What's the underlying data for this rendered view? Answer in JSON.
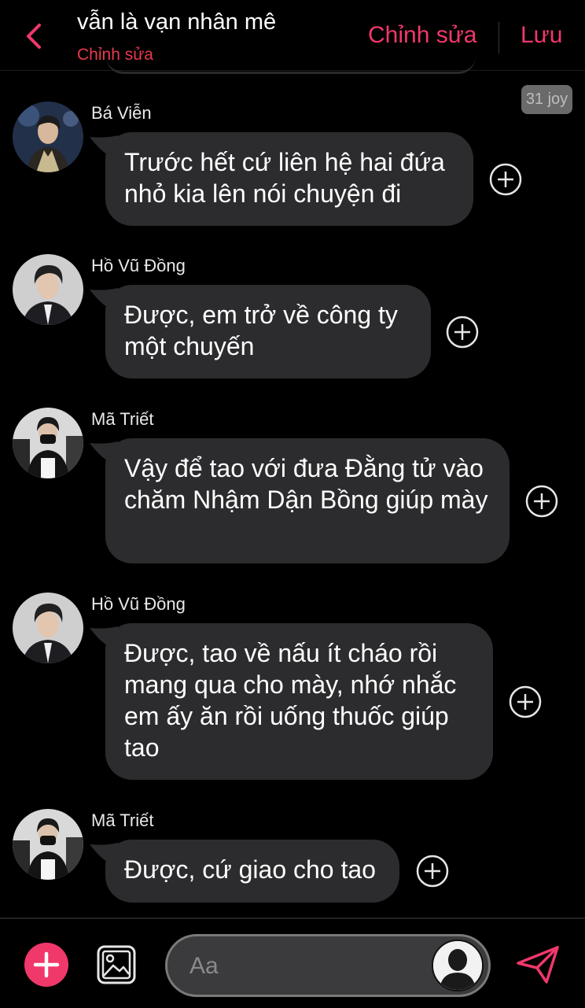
{
  "header": {
    "title": "vẫn là vạn nhân mê",
    "subtitle": "Chỉnh sửa",
    "edit_label": "Chỉnh sửa",
    "save_label": "Lưu",
    "accent": "#f0386b"
  },
  "timestamp": "31 joy",
  "messages": [
    {
      "sender": "Bá Viễn",
      "text": "Trước hết cứ liên hệ hai đứa nhỏ kia lên nói chuyện đi"
    },
    {
      "sender": "Hồ Vũ Đồng",
      "text": "Được, em trở về công ty một chuyến"
    },
    {
      "sender": "Mã Triết",
      "text": "Vậy để tao với đưa Đằng tử vào chăm Nhậm Dận Bồng giúp mày"
    },
    {
      "sender": "Hồ Vũ Đồng",
      "text": "Được, tao về nấu ít cháo rồi mang qua cho mày, nhớ nhắc em ấy ăn rồi uống thuốc giúp tao"
    },
    {
      "sender": "Mã Triết",
      "text": "Được, cứ giao cho tao"
    }
  ],
  "composer": {
    "placeholder": "Aa"
  },
  "icons": {
    "back": "chevron-left-icon",
    "add_reaction": "plus-circle-icon",
    "add": "plus-icon",
    "photo": "image-icon",
    "send": "send-icon"
  }
}
